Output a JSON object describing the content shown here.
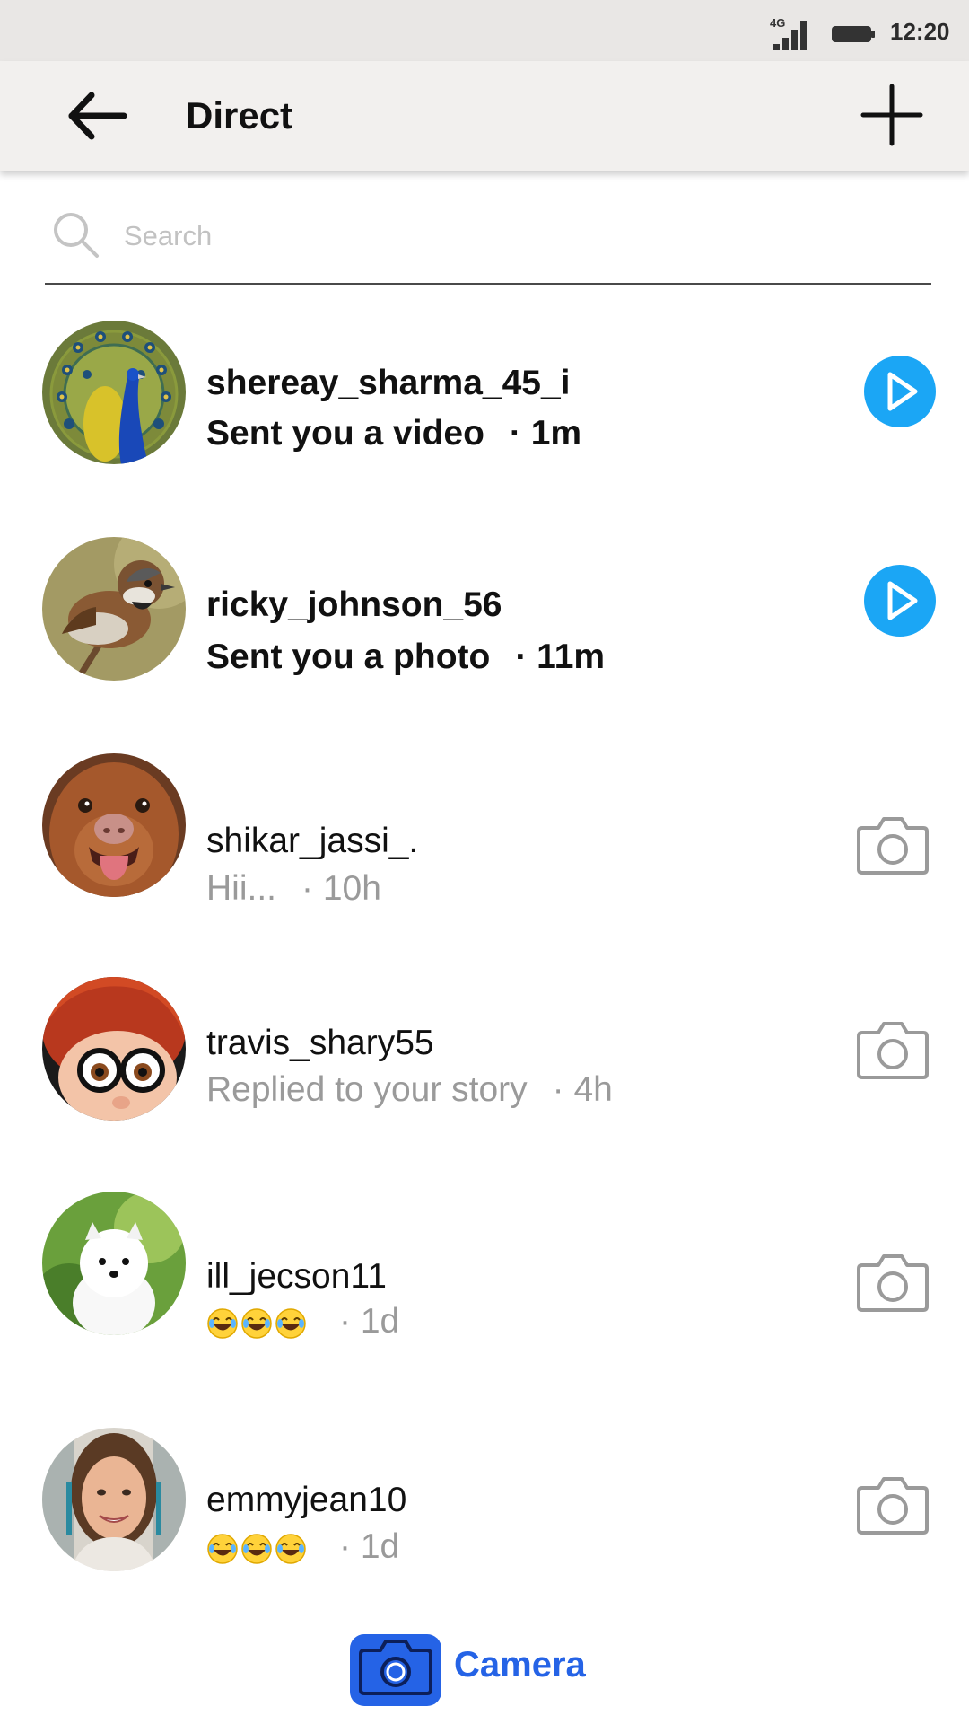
{
  "status_bar": {
    "network": "4G",
    "time": "12:20"
  },
  "header": {
    "title": "Direct",
    "back_icon": "arrow-left-icon",
    "new_icon": "plus-icon"
  },
  "search": {
    "placeholder": "Search",
    "value": ""
  },
  "conversations": [
    {
      "username": "shereay_sharma_45_i",
      "preview": "Sent you a video",
      "time": "· 1m",
      "unread": true,
      "action_icon": "play-icon",
      "avatar": "peacock-avatar"
    },
    {
      "username": "ricky_johnson_56",
      "preview": "Sent you a photo",
      "time": "· 11m",
      "unread": true,
      "action_icon": "play-icon",
      "avatar": "sparrow-avatar"
    },
    {
      "username": "shikar_jassi_.",
      "preview": "Hii...",
      "time": "· 10h",
      "unread": false,
      "action_icon": "camera-icon",
      "avatar": "dog-avatar"
    },
    {
      "username": "travis_shary55",
      "preview": "Replied to your story",
      "time": "· 4h",
      "unread": false,
      "action_icon": "camera-icon",
      "avatar": "cartoon-boy-avatar"
    },
    {
      "username": "ill_jecson11",
      "preview": "😂😂😂",
      "time": "· 1d",
      "unread": false,
      "action_icon": "camera-icon",
      "avatar": "white-puppy-avatar"
    },
    {
      "username": "emmyjean10",
      "preview": "😂😂😂",
      "time": "· 1d",
      "unread": false,
      "action_icon": "camera-icon",
      "avatar": "woman-avatar"
    }
  ],
  "footer": {
    "camera_label": "Camera"
  },
  "colors": {
    "accent_blue": "#2563e6",
    "play_cyan": "#1ba6f5",
    "muted_text": "#9a9a9a"
  }
}
